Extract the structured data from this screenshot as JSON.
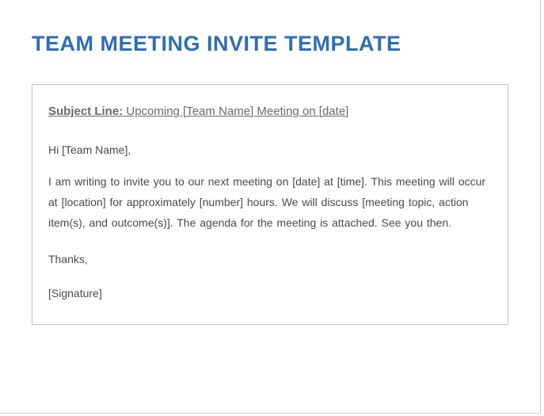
{
  "document": {
    "title": "TEAM MEETING INVITE TEMPLATE",
    "subject_label": "Subject Line:",
    "subject_text": " Upcoming [Team Name] Meeting on [date]",
    "greeting": "Hi [Team Name],",
    "main_paragraph": "I am writing to invite you to our next meeting on [date] at [time]. This meeting will occur at [location] for approximately [number] hours. We will discuss [meeting topic, action item(s), and outcome(s)]. The agenda for the meeting is attached. See you then.",
    "thanks": "Thanks,",
    "signature": "[Signature]"
  }
}
